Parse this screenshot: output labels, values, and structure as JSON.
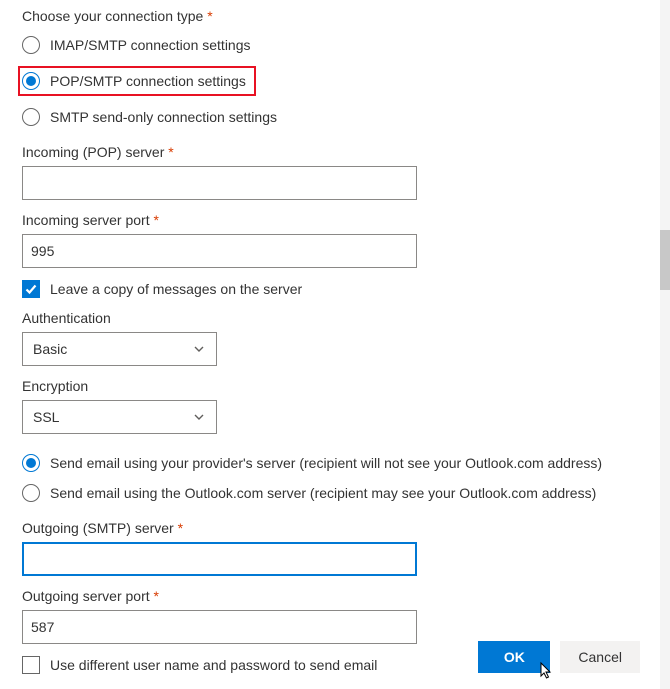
{
  "connection_type": {
    "label": "Choose your connection type",
    "required": "*",
    "options": {
      "imap": "IMAP/SMTP connection settings",
      "pop": "POP/SMTP connection settings",
      "smtp_only": "SMTP send-only connection settings"
    },
    "selected": "pop"
  },
  "incoming_server": {
    "label": "Incoming (POP) server",
    "required": "*",
    "value": ""
  },
  "incoming_port": {
    "label": "Incoming server port",
    "required": "*",
    "value": "995"
  },
  "leave_copy": {
    "label": "Leave a copy of messages on the server",
    "checked": true
  },
  "authentication": {
    "label": "Authentication",
    "value": "Basic"
  },
  "encryption": {
    "label": "Encryption",
    "value": "SSL"
  },
  "send_via": {
    "provider": "Send email using your provider's server (recipient will not see your Outlook.com address)",
    "outlook": "Send email using the Outlook.com server (recipient may see your Outlook.com address)",
    "selected": "provider"
  },
  "outgoing_server": {
    "label": "Outgoing (SMTP) server",
    "required": "*",
    "value": ""
  },
  "outgoing_port": {
    "label": "Outgoing server port",
    "required": "*",
    "value": "587"
  },
  "diff_credentials": {
    "label": "Use different user name and password to send email",
    "checked": false
  },
  "buttons": {
    "ok": "OK",
    "cancel": "Cancel"
  }
}
